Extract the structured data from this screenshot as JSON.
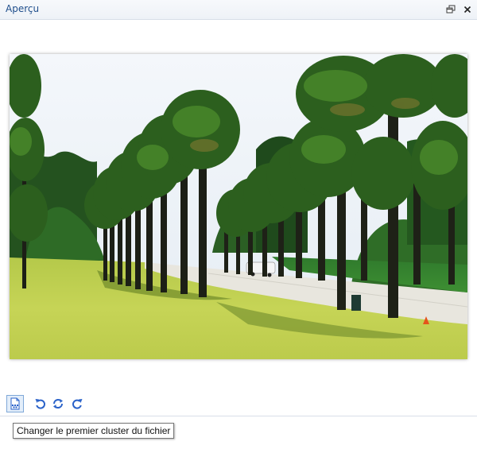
{
  "panel": {
    "title": "Aperçu",
    "undock_icon": "undock-icon",
    "close_icon": "close-icon"
  },
  "preview_image": {
    "subject": "palm-lined-road-photo"
  },
  "toolbar": {
    "buttons": [
      {
        "icon": "change-cluster-icon",
        "active": true
      },
      {
        "icon": "rotate-left-icon"
      },
      {
        "icon": "rotate-both-icon"
      },
      {
        "icon": "rotate-right-icon"
      }
    ]
  },
  "tooltip": {
    "text": "Changer le premier cluster du fichier"
  },
  "colors": {
    "accent": "#1f4e8c",
    "icon_blue": "#2a62c9"
  }
}
